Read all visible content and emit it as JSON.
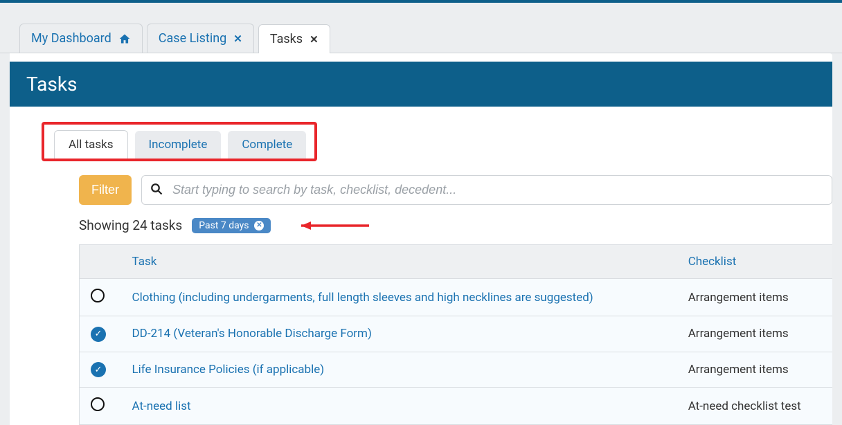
{
  "nav_tabs": {
    "dashboard": {
      "label": "My Dashboard"
    },
    "case_listing": {
      "label": "Case Listing"
    },
    "tasks": {
      "label": "Tasks"
    }
  },
  "page_title": "Tasks",
  "sub_tabs": {
    "all": "All tasks",
    "incomplete": "Incomplete",
    "complete": "Complete"
  },
  "filter": {
    "button_label": "Filter",
    "search_placeholder": "Start typing to search by task, checklist, decedent..."
  },
  "showing_text": "Showing 24 tasks",
  "chip": {
    "label": "Past 7 days"
  },
  "table": {
    "headers": {
      "task": "Task",
      "checklist": "Checklist"
    },
    "rows": [
      {
        "done": false,
        "task": "Clothing (including undergarments, full length sleeves and high necklines are suggested)",
        "checklist": "Arrangement items"
      },
      {
        "done": true,
        "task": "DD-214 (Veteran's Honorable Discharge Form)",
        "checklist": "Arrangement items"
      },
      {
        "done": true,
        "task": "Life Insurance Policies (if applicable)",
        "checklist": "Arrangement items"
      },
      {
        "done": false,
        "task": "At-need list",
        "checklist": "At-need checklist test"
      }
    ]
  }
}
